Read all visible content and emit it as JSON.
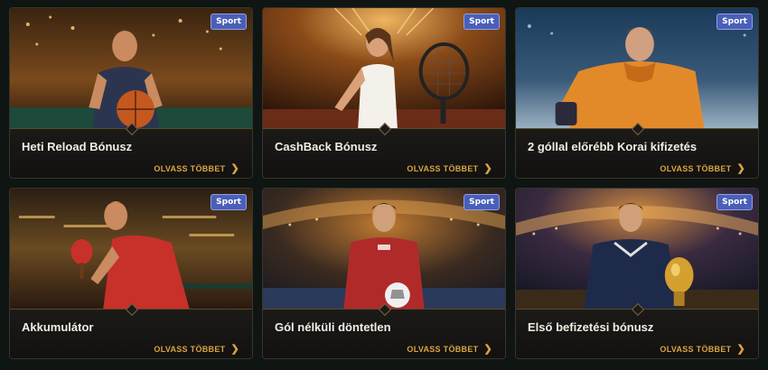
{
  "cards": [
    {
      "badge": "Sport",
      "title": "Heti Reload Bónusz",
      "link": "OLVASS TÖBBET",
      "scene": "basketball-player"
    },
    {
      "badge": "Sport",
      "title": "CashBack Bónusz",
      "link": "OLVASS TÖBBET",
      "scene": "tennis-player"
    },
    {
      "badge": "Sport",
      "title": "2 góllal előrébb Korai kifizetés",
      "link": "OLVASS TÖBBET",
      "scene": "hockey-goalie"
    },
    {
      "badge": "Sport",
      "title": "Akkumulátor",
      "link": "OLVASS TÖBBET",
      "scene": "table-tennis-player"
    },
    {
      "badge": "Sport",
      "title": "Gól nélküli döntetlen",
      "link": "OLVASS TÖBBET",
      "scene": "soccer-player"
    },
    {
      "badge": "Sport",
      "title": "Első befizetési bónusz",
      "link": "OLVASS TÖBBET",
      "scene": "trophy-player"
    }
  ],
  "colors": {
    "accent": "#d9a441",
    "badge": "#4a5fb8",
    "background": "#0e1512"
  }
}
